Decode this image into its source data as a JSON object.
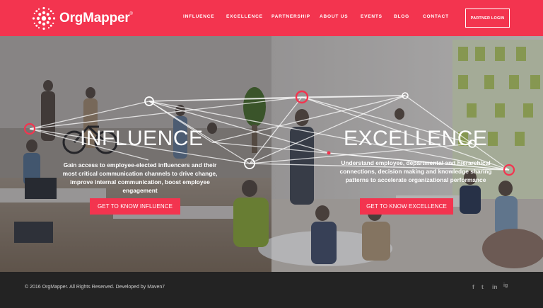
{
  "brand": {
    "name": "OrgMapper",
    "mark": "®"
  },
  "nav": {
    "items": [
      "INFLUENCE",
      "EXCELLENCE",
      "PARTNERSHIP",
      "ABOUT US",
      "EVENTS",
      "BLOG",
      "CONTACT"
    ],
    "login": "PARTNER LOGIN"
  },
  "hero": {
    "left": {
      "title": "INFLUENCE",
      "text": "Gain access to employee-elected influencers and their most critical communication channels to drive change, improve internal communication, boost employee engagement",
      "cta": "GET TO KNOW INFLUENCE"
    },
    "right": {
      "title": "EXCELLENCE",
      "text": "Understand employee, departmental and hierarchical connections, decision making and knowledge sharing patterns to accelerate organizational performance",
      "cta": "GET TO KNOW EXCELLENCE"
    }
  },
  "footer": {
    "copyright": "© 2016 OrgMapper. All Rights Reserved. Developed by Maven7",
    "social": [
      "f",
      "t",
      "in",
      "ig"
    ]
  },
  "colors": {
    "accent": "#f3344f",
    "footer_bg": "#232323"
  }
}
